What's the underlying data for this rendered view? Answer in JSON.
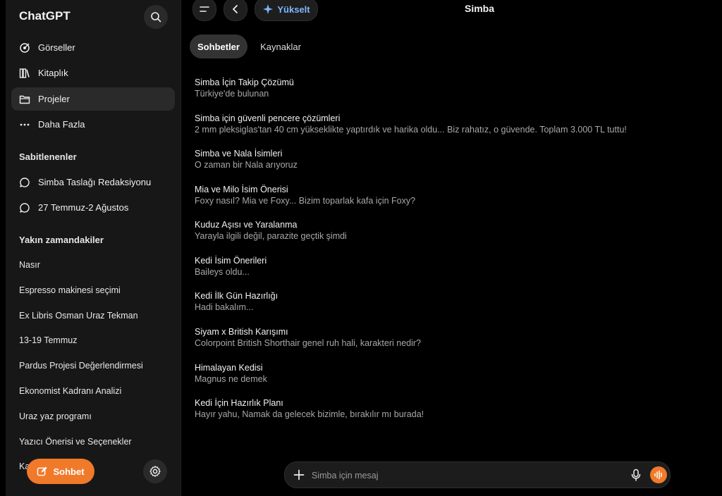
{
  "app": {
    "brand": "ChatGPT"
  },
  "sidebar": {
    "nav": [
      {
        "label": "Görseller",
        "icon": "images-icon"
      },
      {
        "label": "Kitaplık",
        "icon": "library-icon"
      },
      {
        "label": "Projeler",
        "icon": "folder-icon",
        "active": true
      },
      {
        "label": "Daha Fazla",
        "icon": "more-icon"
      }
    ],
    "pinned_title": "Sabitlenenler",
    "pinned": [
      {
        "label": "Simba Taslağı Redaksiyonu"
      },
      {
        "label": "27 Temmuz-2 Ağustos"
      }
    ],
    "recent_title": "Yakın zamandakiler",
    "recent": [
      "Nasır",
      "Espresso makinesi seçimi",
      "Ex Libris Osman Uraz Tekman",
      "13-19 Temmuz",
      "Pardus Projesi Değerlendirmesi",
      "Ekonomist Kadranı Analizi",
      "Uraz yaz programı",
      "Yazıcı Önerisi ve Seçenekler",
      "Ka"
    ],
    "new_chat_label": "Sohbet"
  },
  "topbar": {
    "upgrade_label": "Yükselt",
    "title": "Simba"
  },
  "tabs": [
    {
      "label": "Sohbetler",
      "active": true
    },
    {
      "label": "Kaynaklar",
      "active": false
    }
  ],
  "conversations": [
    {
      "title": "Simba İçin Takip Çözümü",
      "snippet": "Türkiye'de bulunan"
    },
    {
      "title": "Simba için güvenli pencere çözümleri",
      "snippet": "2 mm pleksiglas'tan 40 cm yükseklikte yaptırdık ve harika oldu... Biz rahatız, o güvende. Toplam 3.000 TL tuttu!"
    },
    {
      "title": "Simba ve Nala İsimleri",
      "snippet": "O zaman bir Nala arıyoruz"
    },
    {
      "title": "Mia ve Milo İsim Önerisi",
      "snippet": "Foxy nasıl? Mia ve Foxy... Bizim toparlak kafa için Foxy?"
    },
    {
      "title": "Kuduz Aşısı ve Yaralanma",
      "snippet": "Yarayla ilgili değil, parazite geçtik şimdi"
    },
    {
      "title": "Kedi İsim Önerileri",
      "snippet": "Baileys oldu..."
    },
    {
      "title": "Kedi İlk Gün Hazırlığı",
      "snippet": "Hadi bakalım..."
    },
    {
      "title": "Siyam x British Karışımı",
      "snippet": "Colorpoint British Shorthair genel ruh hali, karakteri nedir?"
    },
    {
      "title": "Himalayan Kedisi",
      "snippet": "Magnus ne demek"
    },
    {
      "title": "Kedi İçin Hazırlık Planı",
      "snippet": "Hayır yahu, Namak da gelecek bizimle, bırakılır mı burada!"
    }
  ],
  "composer": {
    "placeholder": "Simba için mesaj"
  },
  "colors": {
    "accent": "#f07a2a",
    "upgrade": "#7fb7ff",
    "background": "#000000",
    "sidebar": "#171717"
  }
}
